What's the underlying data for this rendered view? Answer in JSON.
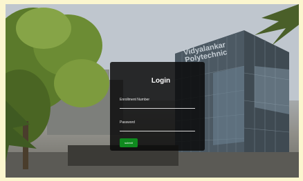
{
  "background": {
    "building_sign": [
      "Vidyalankar",
      "Polytechnic"
    ]
  },
  "login": {
    "title": "Login",
    "enrollment_placeholder": "Enrollment Number",
    "password_placeholder": "Password",
    "submit_label": "submit"
  },
  "colors": {
    "page_border": "#fbf6cf",
    "card_background": "#0a0a0a",
    "submit_button": "#0f8a1e",
    "text": "#ffffff"
  }
}
